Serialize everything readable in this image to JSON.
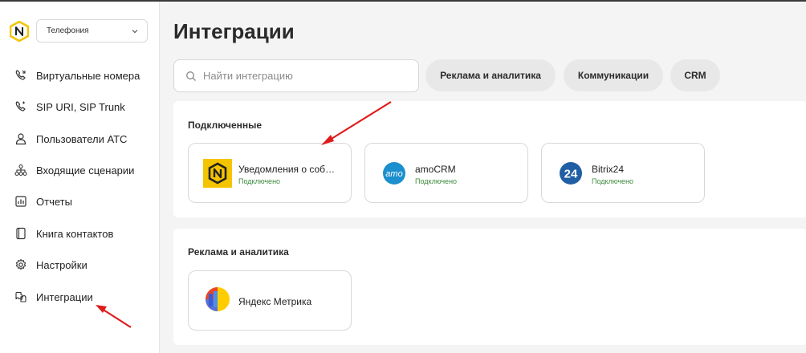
{
  "sidebar": {
    "selector_value": "Телефония",
    "items": [
      {
        "label": "Виртуальные номера",
        "icon": "phone-icon"
      },
      {
        "label": "SIP URI, SIP Trunk",
        "icon": "phone-sip-icon"
      },
      {
        "label": "Пользователи АТС",
        "icon": "user-icon"
      },
      {
        "label": "Входящие сценарии",
        "icon": "scenario-icon"
      },
      {
        "label": "Отчеты",
        "icon": "report-icon"
      },
      {
        "label": "Книга контактов",
        "icon": "contacts-book-icon"
      },
      {
        "label": "Настройки",
        "icon": "gear-icon"
      },
      {
        "label": "Интеграции",
        "icon": "integrations-icon"
      }
    ]
  },
  "main": {
    "title": "Интеграции",
    "search_placeholder": "Найти интеграцию",
    "filters": [
      "Реклама и аналитика",
      "Коммуникации",
      "CRM"
    ],
    "sections": [
      {
        "title": "Подключенные",
        "cards": [
          {
            "name": "Уведомления о событиях",
            "status": "Подключено",
            "icon": "notifications-logo-icon"
          },
          {
            "name": "amoCRM",
            "status": "Подключено",
            "icon": "amocrm-logo-icon"
          },
          {
            "name": "Bitrix24",
            "status": "Подключено",
            "icon": "bitrix24-logo-icon"
          }
        ]
      },
      {
        "title": "Реклама и аналитика",
        "cards": [
          {
            "name": "Яндекс Метрика",
            "icon": "yandex-metrica-logo-icon"
          }
        ]
      }
    ]
  },
  "colors": {
    "brand_yellow": "#f5c400",
    "connected_green": "#3d8b3d",
    "annotation_red": "#e01b1b",
    "amocrm_blue": "#1c8fce",
    "bitrix_blue": "#215fa4"
  }
}
